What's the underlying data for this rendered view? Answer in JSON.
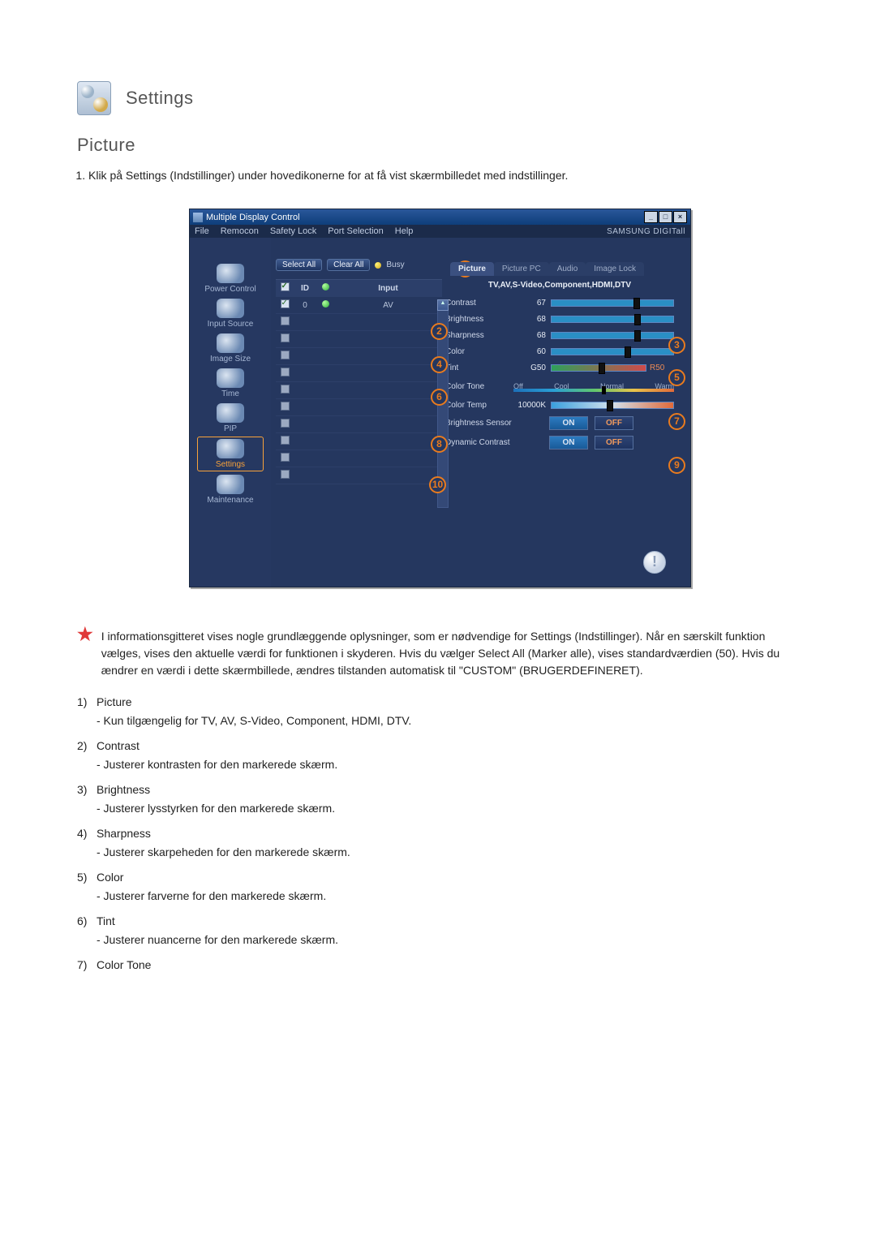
{
  "header": {
    "title": "Settings"
  },
  "section_title": "Picture",
  "intro_steps": [
    "Klik på Settings (Indstillinger) under hovedikonerne for at få vist skærmbilledet med indstillinger."
  ],
  "mdc": {
    "window_title": "Multiple Display Control",
    "window_btns": {
      "min": "_",
      "max": "□",
      "close": "×"
    },
    "menubar": [
      "File",
      "Remocon",
      "Safety Lock",
      "Port Selection",
      "Help"
    ],
    "brand": "SAMSUNG DIGITall",
    "sidebar": [
      {
        "label": "Power Control",
        "selected": false
      },
      {
        "label": "Input Source",
        "selected": false
      },
      {
        "label": "Image Size",
        "selected": false
      },
      {
        "label": "Time",
        "selected": false
      },
      {
        "label": "PIP",
        "selected": false
      },
      {
        "label": "Settings",
        "selected": true
      },
      {
        "label": "Maintenance",
        "selected": false
      }
    ],
    "buttons": {
      "select_all": "Select All",
      "clear_all": "Clear All",
      "busy": "Busy"
    },
    "table": {
      "head": {
        "id": "ID",
        "input": "Input"
      },
      "rows": [
        {
          "checked": true,
          "id": "0",
          "status": true,
          "input": "AV"
        },
        {
          "checked": false
        },
        {
          "checked": false
        },
        {
          "checked": false
        },
        {
          "checked": false
        },
        {
          "checked": false
        },
        {
          "checked": false
        },
        {
          "checked": false
        },
        {
          "checked": false
        },
        {
          "checked": false
        },
        {
          "checked": false
        }
      ]
    },
    "tabs": [
      "Picture",
      "Picture PC",
      "Audio",
      "Image Lock"
    ],
    "source_line": "TV,AV,S-Video,Component,HDMI,DTV",
    "sliders": [
      {
        "label": "Contrast",
        "value": "67",
        "pct": 67
      },
      {
        "label": "Brightness",
        "value": "68",
        "pct": 68
      },
      {
        "label": "Sharpness",
        "value": "68",
        "pct": 68
      },
      {
        "label": "Color",
        "value": "60",
        "pct": 60
      }
    ],
    "tint": {
      "label": "Tint",
      "left": "G50",
      "right": "R50",
      "pct": 50
    },
    "color_tone": {
      "label": "Color Tone",
      "opts": [
        "Off",
        "Cool",
        "Normal",
        "Warm"
      ],
      "sel_index": 2
    },
    "color_temp": {
      "label": "Color Temp",
      "value": "10000K",
      "pct": 45
    },
    "brightness_sensor": {
      "label": "Brightness Sensor",
      "on": "ON",
      "off": "OFF"
    },
    "dynamic_contrast": {
      "label": "Dynamic Contrast",
      "on": "ON",
      "off": "OFF"
    },
    "callouts": [
      "1",
      "2",
      "3",
      "4",
      "5",
      "6",
      "7",
      "8",
      "9",
      "10"
    ]
  },
  "star_note": "I informationsgitteret vises nogle grundlæggende oplysninger, som er nødvendige for Settings (Indstillinger). Når en særskilt funktion vælges, vises den aktuelle værdi for funktionen i skyderen. Hvis du vælger Select All (Marker alle), vises standardværdien (50). Hvis du ændrer en værdi i dette skærmbillede, ændres tilstanden automatisk til \"CUSTOM\" (BRUGERDEFINERET).",
  "desc_list": [
    {
      "num": "1)",
      "title": "Picture",
      "sub": "- Kun tilgængelig for TV, AV, S-Video, Component, HDMI, DTV."
    },
    {
      "num": "2)",
      "title": "Contrast",
      "sub": "- Justerer kontrasten for den markerede skærm."
    },
    {
      "num": "3)",
      "title": "Brightness",
      "sub": "- Justerer lysstyrken for den markerede skærm."
    },
    {
      "num": "4)",
      "title": "Sharpness",
      "sub": "- Justerer skarpeheden for den markerede skærm."
    },
    {
      "num": "5)",
      "title": "Color",
      "sub": "- Justerer farverne for den markerede skærm."
    },
    {
      "num": "6)",
      "title": "Tint",
      "sub": "- Justerer nuancerne for den markerede skærm."
    },
    {
      "num": "7)",
      "title": "Color Tone",
      "sub": ""
    }
  ]
}
